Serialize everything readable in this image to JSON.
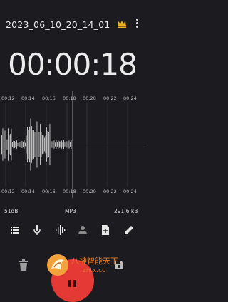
{
  "header": {
    "recording_name": "2023_06_10_20_14_01",
    "premium_icon": "crown-icon",
    "menu_icon": "more-vert-icon"
  },
  "timer": {
    "elapsed": "00:00:18"
  },
  "timeline": {
    "top_labels": [
      "00:12",
      "00:14",
      "00:16",
      "00:18",
      "00:20",
      "00:22",
      "00:24"
    ],
    "bottom_labels": [
      "00:12",
      "00:14",
      "00:16",
      "00:18",
      "00:20",
      "00:22",
      "00:24"
    ]
  },
  "info": {
    "level": "51dB",
    "format": "MP3",
    "size": "291.6 kB"
  },
  "toolbar": {
    "icons": [
      "list-icon",
      "mic-icon",
      "waveform-icon",
      "person-icon",
      "add-file-icon",
      "edit-icon"
    ]
  },
  "bottom": {
    "left_icon": "trash-icon",
    "center_icon": "pause-icon",
    "right_icon": "save-icon"
  },
  "watermark": {
    "line1": "八神智能天下",
    "line2": "zntx.cc"
  },
  "colors": {
    "background": "#1c1b1f",
    "accent": "#e53935",
    "playhead": "#c62828",
    "watermark": "#e07b2a"
  }
}
